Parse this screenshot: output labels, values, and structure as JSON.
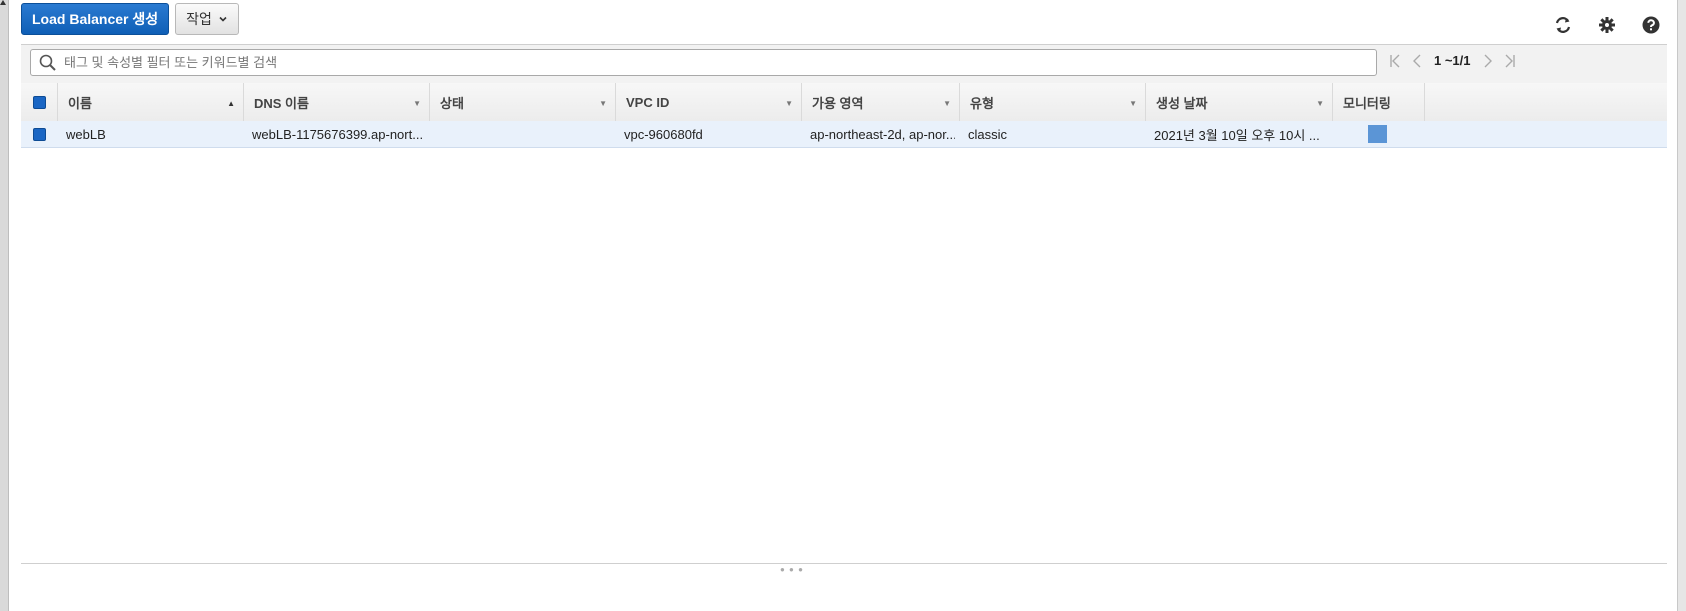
{
  "toolbar": {
    "create_label": "Load Balancer 생성",
    "actions_label": "작업"
  },
  "icons": {
    "refresh": "refresh-icon",
    "settings": "gear-icon",
    "help": "help-icon"
  },
  "search": {
    "placeholder": "태그 및 속성별 필터 또는 키워드별 검색",
    "value": ""
  },
  "pager": {
    "count": "1 ~1/1"
  },
  "table": {
    "columns": [
      "이름",
      "DNS 이름",
      "상태",
      "VPC ID",
      "가용 영역",
      "유형",
      "생성 날짜",
      "모니터링"
    ],
    "rows": [
      {
        "name": "webLB",
        "dns": "webLB-1175676399.ap-nort...",
        "state": "",
        "vpc": "vpc-960680fd",
        "az": "ap-northeast-2d, ap-nor...",
        "type": "classic",
        "created": "2021년 3월 10일 오후 10시 ..."
      }
    ]
  },
  "colors": {
    "primary": "#1a66c4",
    "row_selected": "#e9f1fb",
    "monitor_swatch": "#5b95d6"
  }
}
